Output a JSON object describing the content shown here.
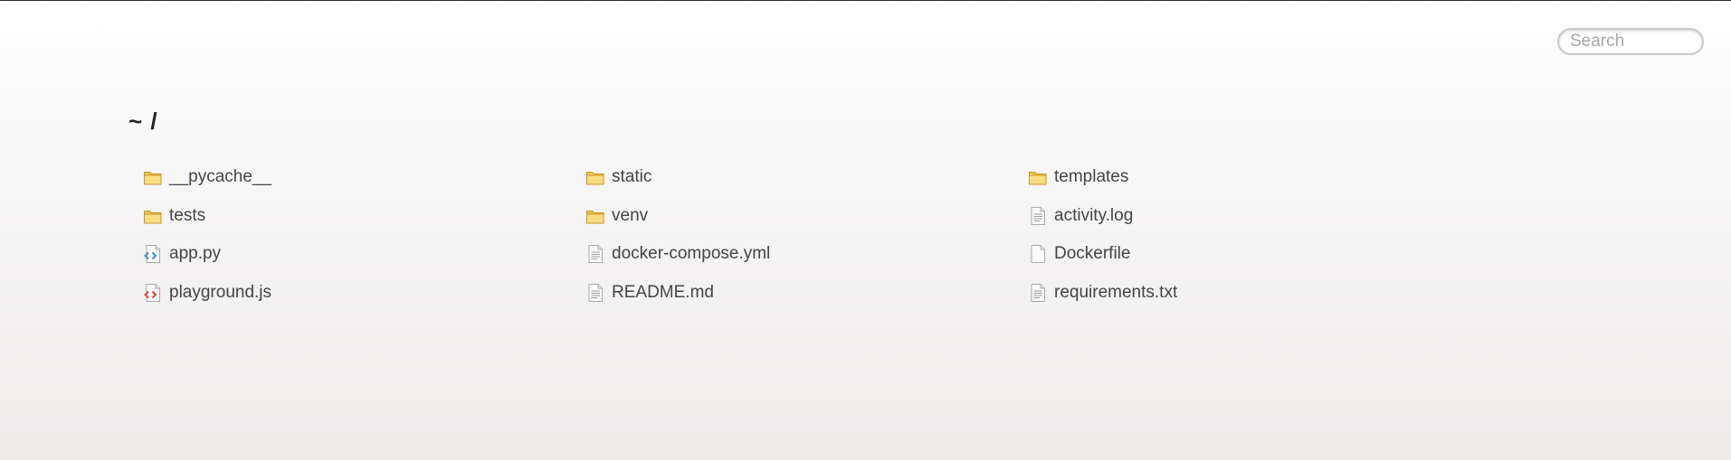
{
  "search": {
    "placeholder": "Search"
  },
  "breadcrumb": "~ /",
  "entries": [
    {
      "name": "__pycache__",
      "type": "folder"
    },
    {
      "name": "static",
      "type": "folder"
    },
    {
      "name": "templates",
      "type": "folder"
    },
    {
      "name": "tests",
      "type": "folder"
    },
    {
      "name": "venv",
      "type": "folder"
    },
    {
      "name": "activity.log",
      "type": "text"
    },
    {
      "name": "app.py",
      "type": "code-blue"
    },
    {
      "name": "docker-compose.yml",
      "type": "text"
    },
    {
      "name": "Dockerfile",
      "type": "blank"
    },
    {
      "name": "playground.js",
      "type": "code-red"
    },
    {
      "name": "README.md",
      "type": "text"
    },
    {
      "name": "requirements.txt",
      "type": "text"
    }
  ],
  "icons": {
    "folder": "folder-icon",
    "text": "text-file-icon",
    "blank": "blank-file-icon",
    "code-blue": "python-file-icon",
    "code-red": "javascript-file-icon"
  },
  "colors": {
    "folder": "#f0c64a",
    "code_blue": "#3b8fd6",
    "code_red": "#e0453a"
  }
}
